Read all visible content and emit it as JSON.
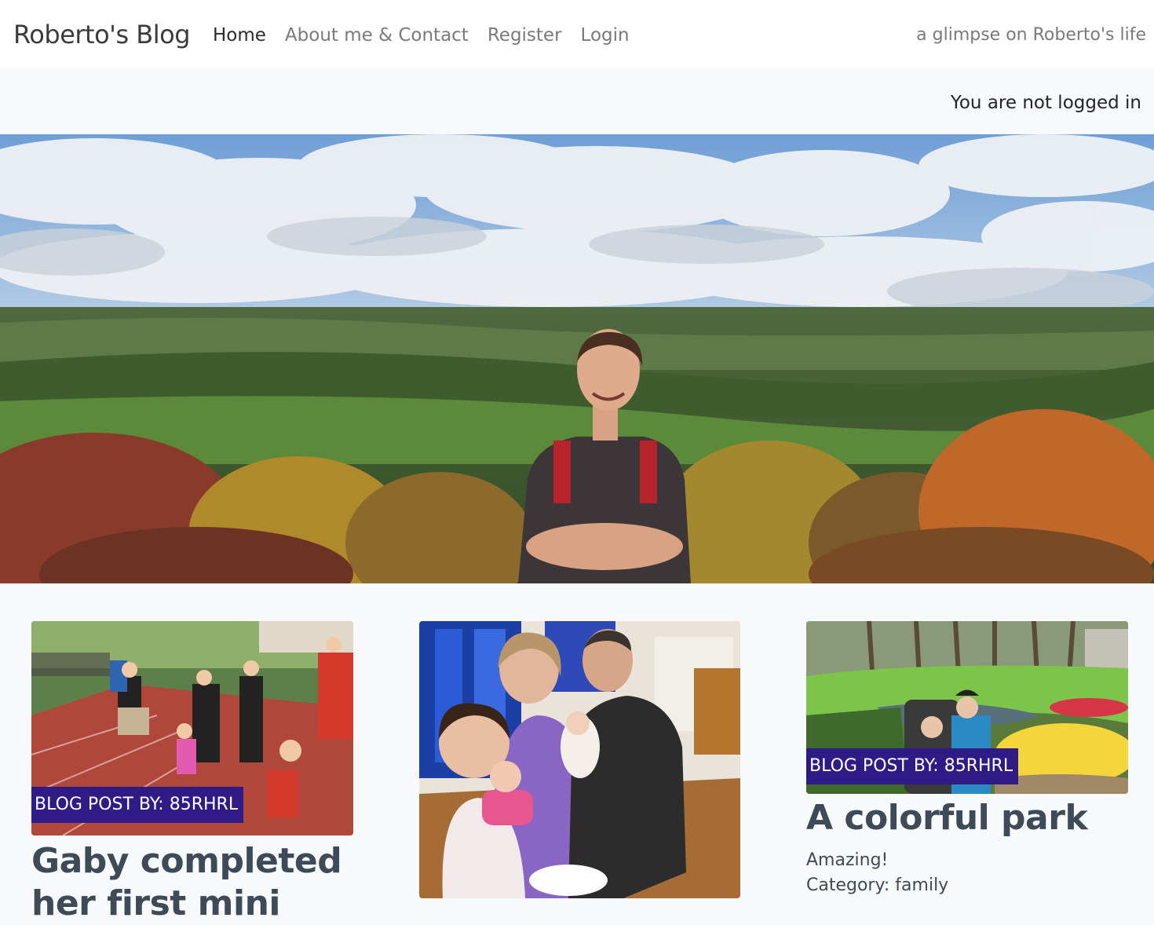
{
  "navbar": {
    "brand": "Roberto's Blog",
    "links": [
      {
        "label": "Home"
      },
      {
        "label": "About me & Contact"
      },
      {
        "label": "Register"
      },
      {
        "label": "Login"
      }
    ],
    "tagline": "a glimpse on Roberto's life"
  },
  "status": "You are not logged in",
  "hero": {
    "icon": "landscape-photo"
  },
  "posts": [
    {
      "badge": "BLOG POST BY: 85RHRL",
      "title": "Gaby completed her first mini",
      "image": "race-photo"
    },
    {
      "badge": "",
      "title": "",
      "image": "family-photo"
    },
    {
      "badge": "BLOG POST BY: 85RHRL",
      "title": "A colorful park",
      "summary": "Amazing!",
      "category": "Category: family",
      "image": "park-photo"
    }
  ],
  "colors": {
    "badge": "#2e1b86",
    "title": "#3d4a57",
    "background": "#f8f9fa"
  }
}
